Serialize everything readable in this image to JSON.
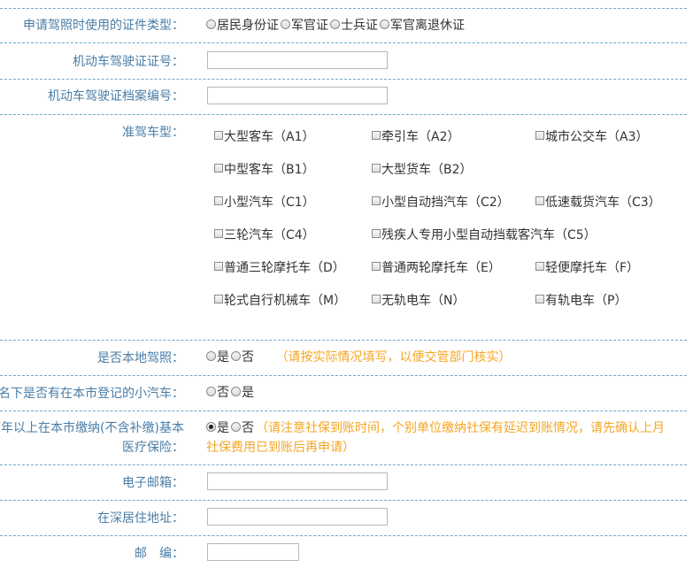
{
  "id_type": {
    "label": "申请驾照时使用的证件类型：",
    "options": [
      "居民身份证",
      "军官证",
      "士兵证",
      "军官离退休证"
    ]
  },
  "license_number": {
    "label": "机动车驾驶证证号：",
    "value": ""
  },
  "license_file_number": {
    "label": "机动车驾驶证档案编号：",
    "value": ""
  },
  "vehicle_class": {
    "label": "准驾车型：",
    "options": [
      "大型客车（A1）",
      "牵引车（A2）",
      "城市公交车（A3）",
      "中型客车（B1）",
      "大型货车（B2）",
      "小型汽车（C1）",
      "小型自动挡汽车（C2）",
      "低速载货汽车（C3）",
      "三轮汽车（C4）",
      "残疾人专用小型自动挡载客汽车（C5）",
      "普通三轮摩托车（D）",
      "普通两轮摩托车（E）",
      "轻便摩托车（F）",
      "轮式自行机械车（M）",
      "无轨电车（N）",
      "有轨电车（P）"
    ]
  },
  "local_license": {
    "label": "是否本地驾照：",
    "options": [
      "是",
      "否"
    ],
    "note": "（请按实际情况填写，以便交管部门核实）"
  },
  "registered_car": {
    "label": "人名下是否有在本市登记的小汽车：",
    "options": [
      "否",
      "是"
    ]
  },
  "insurance": {
    "label_line1": "两年以上在本市缴纳(不含补缴)基本",
    "label_line2": "医疗保险：",
    "options": [
      "是",
      "否"
    ],
    "selected": "是",
    "note_line1": "（请注意社保到账时间，个别单位缴纳社保有延迟到账情况，请先确认上月",
    "note_line2": "社保费用已到账后再申请）"
  },
  "email": {
    "label": "电子邮箱：",
    "value": ""
  },
  "address": {
    "label": "在深居住地址：",
    "value": ""
  },
  "postcode": {
    "label": "邮　编：",
    "value": ""
  }
}
